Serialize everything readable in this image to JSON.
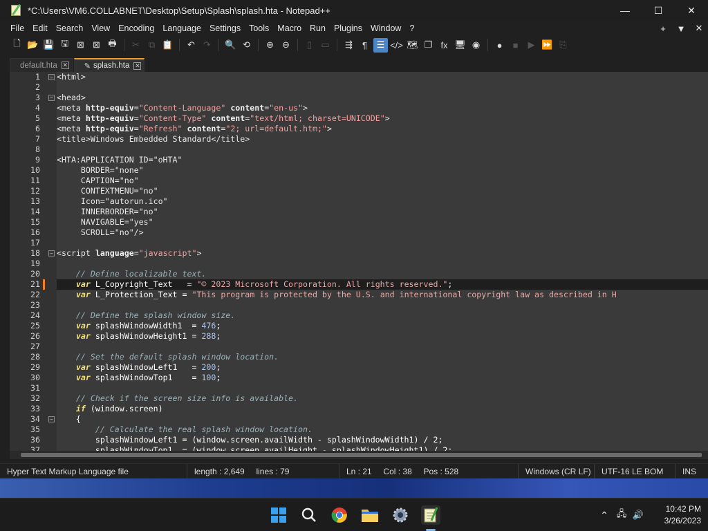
{
  "window": {
    "title": "*C:\\Users\\VM6.COLLABNET\\Desktop\\Setup\\Splash\\splash.hta - Notepad++",
    "minimize_glyph": "—",
    "maximize_glyph": "☐",
    "close_glyph": "✕"
  },
  "menu": {
    "items": [
      "File",
      "Edit",
      "Search",
      "View",
      "Encoding",
      "Language",
      "Settings",
      "Tools",
      "Macro",
      "Run",
      "Plugins",
      "Window",
      "?"
    ],
    "right_buttons": [
      "+",
      "▼",
      "✕"
    ]
  },
  "toolbar": {
    "buttons": [
      {
        "name": "new-file-icon",
        "glyph": "🗋"
      },
      {
        "name": "open-file-icon",
        "glyph": "📂"
      },
      {
        "name": "save-icon",
        "glyph": "💾"
      },
      {
        "name": "save-all-icon",
        "glyph": "🖫"
      },
      {
        "name": "close-icon",
        "glyph": "⊠"
      },
      {
        "name": "close-all-icon",
        "glyph": "⊠"
      },
      {
        "name": "print-icon",
        "glyph": "🖶"
      },
      {
        "name": "cut-icon",
        "glyph": "✂"
      },
      {
        "name": "copy-icon",
        "glyph": "⧉"
      },
      {
        "name": "paste-icon",
        "glyph": "📋"
      },
      {
        "name": "undo-icon",
        "glyph": "↶"
      },
      {
        "name": "redo-icon",
        "glyph": "↷"
      },
      {
        "name": "find-icon",
        "glyph": "🔍"
      },
      {
        "name": "replace-icon",
        "glyph": "⟲"
      },
      {
        "name": "zoom-in-icon",
        "glyph": "⊕"
      },
      {
        "name": "zoom-out-icon",
        "glyph": "⊖"
      },
      {
        "name": "sync-vertical-icon",
        "glyph": "▯"
      },
      {
        "name": "sync-horizontal-icon",
        "glyph": "▭"
      },
      {
        "name": "word-wrap-icon",
        "glyph": "⇶"
      },
      {
        "name": "show-all-chars-icon",
        "glyph": "¶"
      },
      {
        "name": "indent-guide-icon",
        "glyph": "☰"
      },
      {
        "name": "xml-tag-icon",
        "glyph": "</>"
      },
      {
        "name": "document-map-icon",
        "glyph": "🗺"
      },
      {
        "name": "document-list-icon",
        "glyph": "❐"
      },
      {
        "name": "function-list-icon",
        "glyph": "fx"
      },
      {
        "name": "folder-workspace-icon",
        "glyph": "🖥"
      },
      {
        "name": "monitoring-icon",
        "glyph": "◉"
      },
      {
        "name": "record-macro-icon",
        "glyph": "●"
      },
      {
        "name": "stop-macro-icon",
        "glyph": "■"
      },
      {
        "name": "play-macro-icon",
        "glyph": "▶"
      },
      {
        "name": "run-macro-multiple-icon",
        "glyph": "⏩"
      },
      {
        "name": "save-macro-icon",
        "glyph": "⎘"
      }
    ]
  },
  "tabs": [
    {
      "label": "default.hta",
      "close": "✕",
      "active": false
    },
    {
      "label": "splash.hta",
      "close": "✕",
      "active": true
    }
  ],
  "editor": {
    "current_line": 21,
    "lines": [
      {
        "n": "1",
        "fold": "−",
        "tokens": [
          [
            "t-tag",
            "<html>"
          ]
        ]
      },
      {
        "n": "2",
        "tokens": []
      },
      {
        "n": "3",
        "fold": "−",
        "tokens": [
          [
            "t-tag",
            "<head>"
          ]
        ]
      },
      {
        "n": "4",
        "tokens": [
          [
            "t-tag",
            "<meta "
          ],
          [
            "t-attr",
            "http-equiv"
          ],
          [
            "t-tag",
            "="
          ],
          [
            "t-str",
            "\"Content-Language\""
          ],
          [
            "t-tag",
            " "
          ],
          [
            "t-attr",
            "content"
          ],
          [
            "t-tag",
            "="
          ],
          [
            "t-str",
            "\"en-us\""
          ],
          [
            "t-tag",
            ">"
          ]
        ]
      },
      {
        "n": "5",
        "tokens": [
          [
            "t-tag",
            "<meta "
          ],
          [
            "t-attr",
            "http-equiv"
          ],
          [
            "t-tag",
            "="
          ],
          [
            "t-str",
            "\"Content-Type\""
          ],
          [
            "t-tag",
            " "
          ],
          [
            "t-attr",
            "content"
          ],
          [
            "t-tag",
            "="
          ],
          [
            "t-str",
            "\"text/html; charset=UNICODE\""
          ],
          [
            "t-tag",
            ">"
          ]
        ]
      },
      {
        "n": "6",
        "tokens": [
          [
            "t-tag",
            "<meta "
          ],
          [
            "t-attr",
            "http-equiv"
          ],
          [
            "t-tag",
            "="
          ],
          [
            "t-str",
            "\"Refresh\""
          ],
          [
            "t-tag",
            " "
          ],
          [
            "t-attr",
            "content"
          ],
          [
            "t-tag",
            "="
          ],
          [
            "t-str",
            "\"2; url=default.htm;\""
          ],
          [
            "t-tag",
            ">"
          ]
        ]
      },
      {
        "n": "7",
        "tokens": [
          [
            "t-tag",
            "<title>Windows Embedded Standard</title>"
          ]
        ]
      },
      {
        "n": "8",
        "tokens": []
      },
      {
        "n": "9",
        "tokens": [
          [
            "t-tag",
            "<HTA:APPLICATION ID=\"oHTA\""
          ]
        ]
      },
      {
        "n": "10",
        "tokens": [
          [
            "t-tag",
            "     BORDER=\"none\""
          ]
        ]
      },
      {
        "n": "11",
        "tokens": [
          [
            "t-tag",
            "     CAPTION=\"no\""
          ]
        ]
      },
      {
        "n": "12",
        "tokens": [
          [
            "t-tag",
            "     CONTEXTMENU=\"no\""
          ]
        ]
      },
      {
        "n": "13",
        "tokens": [
          [
            "t-tag",
            "     Icon=\"autorun.ico\""
          ]
        ]
      },
      {
        "n": "14",
        "tokens": [
          [
            "t-tag",
            "     INNERBORDER=\"no\""
          ]
        ]
      },
      {
        "n": "15",
        "tokens": [
          [
            "t-tag",
            "     NAVIGABLE=\"yes\""
          ]
        ]
      },
      {
        "n": "16",
        "tokens": [
          [
            "t-tag",
            "     SCROLL=\"no\"/>"
          ]
        ]
      },
      {
        "n": "17",
        "tokens": []
      },
      {
        "n": "18",
        "fold": "−",
        "tokens": [
          [
            "t-tag",
            "<script "
          ],
          [
            "t-attr",
            "language"
          ],
          [
            "t-tag",
            "="
          ],
          [
            "t-str",
            "\"javascript\""
          ],
          [
            "t-tag",
            ">"
          ]
        ]
      },
      {
        "n": "19",
        "tokens": []
      },
      {
        "n": "20",
        "tokens": [
          [
            "t-com",
            "    // Define localizable text."
          ]
        ]
      },
      {
        "n": "21",
        "change": true,
        "tokens": [
          [
            "t-plain",
            "    "
          ],
          [
            "t-kw",
            "var"
          ],
          [
            "t-bright",
            " L_Copyright_Text   = "
          ],
          [
            "t-str2",
            "\"© 2023 Microsoft Corporation. All rights reserved.\""
          ],
          [
            "t-bright",
            ";"
          ]
        ]
      },
      {
        "n": "22",
        "tokens": [
          [
            "t-plain",
            "    "
          ],
          [
            "t-kw",
            "var"
          ],
          [
            "t-bright",
            " L_Protection_Text = "
          ],
          [
            "t-str2",
            "\"This program is protected by the U.S. and international copyright law as described in H"
          ]
        ]
      },
      {
        "n": "23",
        "tokens": []
      },
      {
        "n": "24",
        "tokens": [
          [
            "t-com",
            "    // Define the splash window size."
          ]
        ]
      },
      {
        "n": "25",
        "tokens": [
          [
            "t-plain",
            "    "
          ],
          [
            "t-kw",
            "var"
          ],
          [
            "t-bright",
            " splashWindowWidth1  = "
          ],
          [
            "t-num",
            "476"
          ],
          [
            "t-bright",
            ";"
          ]
        ]
      },
      {
        "n": "26",
        "tokens": [
          [
            "t-plain",
            "    "
          ],
          [
            "t-kw",
            "var"
          ],
          [
            "t-bright",
            " splashWindowHeight1 = "
          ],
          [
            "t-num",
            "288"
          ],
          [
            "t-bright",
            ";"
          ]
        ]
      },
      {
        "n": "27",
        "tokens": []
      },
      {
        "n": "28",
        "tokens": [
          [
            "t-com",
            "    // Set the default splash window location."
          ]
        ]
      },
      {
        "n": "29",
        "tokens": [
          [
            "t-plain",
            "    "
          ],
          [
            "t-kw",
            "var"
          ],
          [
            "t-bright",
            " splashWindowLeft1   = "
          ],
          [
            "t-num",
            "200"
          ],
          [
            "t-bright",
            ";"
          ]
        ]
      },
      {
        "n": "30",
        "tokens": [
          [
            "t-plain",
            "    "
          ],
          [
            "t-kw",
            "var"
          ],
          [
            "t-bright",
            " splashWindowTop1    = "
          ],
          [
            "t-num",
            "100"
          ],
          [
            "t-bright",
            ";"
          ]
        ]
      },
      {
        "n": "31",
        "tokens": []
      },
      {
        "n": "32",
        "tokens": [
          [
            "t-com",
            "    // Check if the screen size info is available."
          ]
        ]
      },
      {
        "n": "33",
        "tokens": [
          [
            "t-plain",
            "    "
          ],
          [
            "t-kw",
            "if"
          ],
          [
            "t-bright",
            " (window.screen)"
          ]
        ]
      },
      {
        "n": "34",
        "fold": "−",
        "tokens": [
          [
            "t-bright",
            "    {"
          ]
        ]
      },
      {
        "n": "35",
        "tokens": [
          [
            "t-com",
            "        // Calculate the real splash window location."
          ]
        ]
      },
      {
        "n": "36",
        "tokens": [
          [
            "t-bright",
            "        splashWindowLeft1 = (window.screen.availWidth - splashWindowWidth1) / 2;"
          ]
        ]
      },
      {
        "n": "37",
        "tokens": [
          [
            "t-bright",
            "        splashWindowTop1  = (window.screen.availHeight - splashWindowHeight1) / 2;"
          ]
        ]
      }
    ]
  },
  "status": {
    "file_type": "Hyper Text Markup Language file",
    "length": "length : 2,649",
    "lines": "lines : 79",
    "ln": "Ln : 21",
    "col": "Col : 38",
    "pos": "Pos : 528",
    "eol": "Windows (CR LF)",
    "encoding": "UTF-16 LE BOM",
    "ins": "INS"
  },
  "taskbar": {
    "apps": [
      {
        "name": "start-button",
        "label": "Start"
      },
      {
        "name": "search-taskbar-icon",
        "label": "Search"
      },
      {
        "name": "chrome-icon",
        "label": "Chrome"
      },
      {
        "name": "file-explorer-icon",
        "label": "File Explorer"
      },
      {
        "name": "settings-icon",
        "label": "Settings"
      },
      {
        "name": "notepad-plus-plus-icon",
        "label": "Notepad++"
      }
    ],
    "time": "10:42 PM",
    "date": "3/26/2023"
  }
}
